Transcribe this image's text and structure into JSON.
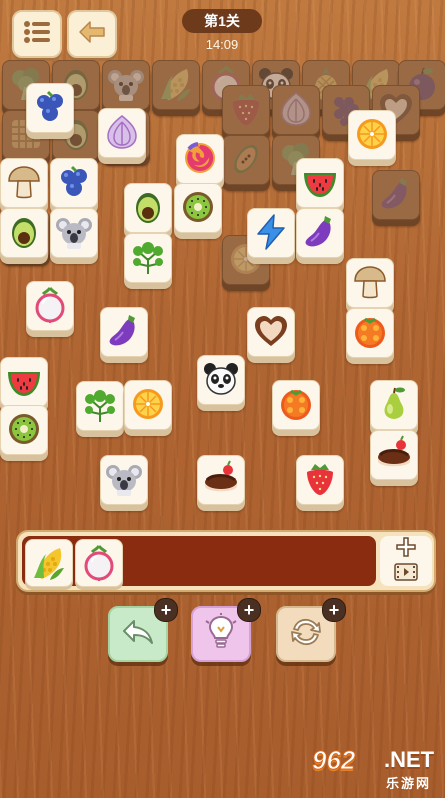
{
  "header": {
    "level": "第1关",
    "timer": "14:09"
  },
  "board": {
    "tiles": [
      {
        "icon": "broccoli",
        "dim": true
      },
      {
        "icon": "avocado",
        "dim": true
      },
      {
        "icon": "koala",
        "dim": true
      },
      {
        "icon": "corn",
        "dim": true
      },
      {
        "icon": "radish",
        "dim": true
      },
      {
        "icon": "panda",
        "dim": true
      },
      {
        "icon": "pineapple",
        "dim": true
      },
      {
        "icon": "corn",
        "dim": true
      },
      {
        "icon": "plum",
        "dim": true
      },
      {
        "icon": "waffle",
        "dim": true
      },
      {
        "icon": "avocado",
        "dim": true
      },
      {
        "icon": "lollipop",
        "dim": true
      },
      {
        "icon": "strawberry",
        "dim": true
      },
      {
        "icon": "onion",
        "dim": true
      },
      {
        "icon": "grapes",
        "dim": true
      },
      {
        "icon": "heart-cookie",
        "dim": true
      },
      {
        "icon": "waffle",
        "dim": true
      },
      {
        "icon": "papaya",
        "dim": true
      },
      {
        "icon": "broccoli",
        "dim": true
      },
      {
        "icon": "orange",
        "dim": true
      },
      {
        "icon": "eggplant",
        "dim": true
      },
      {
        "icon": "blueberries",
        "dim": false
      },
      {
        "icon": "onion",
        "dim": false
      },
      {
        "icon": "lollipop",
        "dim": false
      },
      {
        "icon": "orange",
        "dim": false
      },
      {
        "icon": "mushroom",
        "dim": false
      },
      {
        "icon": "blueberries",
        "dim": false
      },
      {
        "icon": "avocado",
        "dim": false
      },
      {
        "icon": "kiwi",
        "dim": false
      },
      {
        "icon": "watermelon",
        "dim": false
      },
      {
        "icon": "avocado",
        "dim": false
      },
      {
        "icon": "koala",
        "dim": false
      },
      {
        "icon": "parsley",
        "dim": false
      },
      {
        "icon": "lightning",
        "dim": false
      },
      {
        "icon": "eggplant",
        "dim": false
      },
      {
        "icon": "mushroom",
        "dim": false
      },
      {
        "icon": "radish",
        "dim": false
      },
      {
        "icon": "eggplant",
        "dim": false
      },
      {
        "icon": "heart-cookie",
        "dim": false
      },
      {
        "icon": "tomato",
        "dim": false
      },
      {
        "icon": "watermelon",
        "dim": false
      },
      {
        "icon": "panda",
        "dim": false
      },
      {
        "icon": "parsley",
        "dim": false
      },
      {
        "icon": "orange",
        "dim": false
      },
      {
        "icon": "tomato",
        "dim": false
      },
      {
        "icon": "pear",
        "dim": false
      },
      {
        "icon": "kiwi",
        "dim": false
      },
      {
        "icon": "chocolate-cake",
        "dim": false
      },
      {
        "icon": "koala",
        "dim": false
      },
      {
        "icon": "chocolate-cake",
        "dim": false
      },
      {
        "icon": "strawberry",
        "dim": false
      }
    ]
  },
  "tray": {
    "tiles": [
      {
        "icon": "corn"
      },
      {
        "icon": "radish"
      }
    ]
  },
  "actions": {
    "undo_icon": "undo-arrow-icon",
    "hint_icon": "lightbulb-icon",
    "shuffle_icon": "shuffle-icon"
  },
  "watermark": {
    "number": "962",
    "net": ".NET",
    "site": "乐游网"
  },
  "colors": {
    "tile_face": "#fdf6ea",
    "tray_slot": "#8a2c10",
    "level_pill": "#6e3a1c"
  }
}
